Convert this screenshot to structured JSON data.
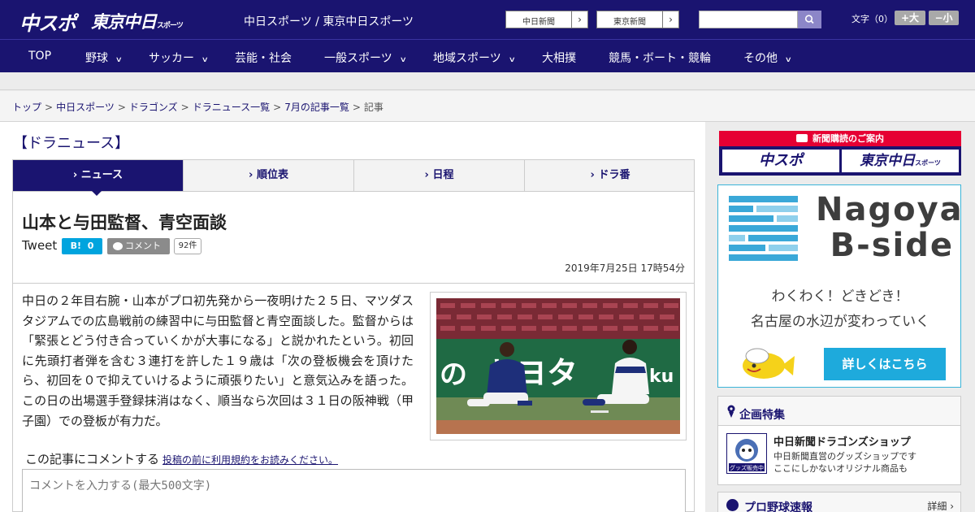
{
  "header": {
    "logo_chunichi": "中スポ",
    "logo_tokyo": "東京中日",
    "logo_tokyo_suffix": "スポーツ",
    "site_caption": "中日スポーツ / 東京中日スポーツ",
    "ext_links": [
      {
        "label": "中日新聞",
        "arrow": "›"
      },
      {
        "label": "東京新聞",
        "arrow": "›"
      }
    ],
    "search_placeholder": "",
    "font_size_label": "文字（0）",
    "font_bigger": "+大",
    "font_smaller": "−小"
  },
  "nav": {
    "items": [
      {
        "label": "TOP",
        "has_menu": false
      },
      {
        "label": "野球",
        "has_menu": true
      },
      {
        "label": "サッカー",
        "has_menu": true
      },
      {
        "label": "芸能・社会",
        "has_menu": false
      },
      {
        "label": "一般スポーツ",
        "has_menu": true
      },
      {
        "label": "地域スポーツ",
        "has_menu": true
      },
      {
        "label": "大相撲",
        "has_menu": false
      },
      {
        "label": "競馬・ボート・競輪",
        "has_menu": false
      },
      {
        "label": "その他",
        "has_menu": true
      }
    ],
    "chevron": "∨"
  },
  "breadcrumb": {
    "items": [
      "トップ",
      "中日スポーツ",
      "ドラゴンズ",
      "ドラニュース一覧",
      "7月の記事一覧"
    ],
    "current": "記事",
    "separator": ">"
  },
  "section_title": "【ドラニュース】",
  "tabs": [
    {
      "label": "ニュース",
      "active": true
    },
    {
      "label": "順位表",
      "active": false
    },
    {
      "label": "日程",
      "active": false
    },
    {
      "label": "ドラ番",
      "active": false
    }
  ],
  "tab_marker": "›",
  "article": {
    "headline": "山本と与田監督、青空面談",
    "tweet_label": "Tweet",
    "hatena_label": "B!",
    "hatena_count": "0",
    "comment_button": "コメント",
    "comment_count": "92件",
    "date": "2019年7月25日 17時54分",
    "body": "中日の２年目右腕・山本がプロ初先発から一夜明けた２５日、マツダスタジアムでの広島戦前の練習中に与田監督と青空面談した。監督からは「緊張とどう付き合っていくかが大事になる」と説かれたという。初回に先頭打者弾を含む３連打を許した１９歳は「次の登板機会を頂けたら、初回を０で抑えていけるように頑張りたい」と意気込みを語った。この日の出場選手登録抹消はなく、順当なら次回は３１日の阪神戦（甲子園）での登板が有力だ。",
    "photo_text_left": "の",
    "photo_text_mid": "トヨタ",
    "photo_text_right": "ku",
    "comment_prompt": "この記事にコメントする",
    "terms_link": "投稿の前に利用規約をお読みください。",
    "comment_placeholder": "コメントを入力する(最大500文字)"
  },
  "sidebar": {
    "subscribe_title": "新聞購読のご案内",
    "subscribe_chunichi": "中スポ",
    "subscribe_tokyo": "東京中日",
    "subscribe_tokyo_suffix": "スポーツ",
    "ad_title_line1": "Nagoya",
    "ad_title_line2": "B-side",
    "ad_line1": "わくわく！どきどき！",
    "ad_line2": "名古屋の水辺が変わっていく",
    "ad_cta": "詳しくはこちら",
    "kikaku_title": "企画特集",
    "shop_title": "中日新聞ドラゴンズショップ",
    "shop_desc1": "中日新聞直営のグッズショップです",
    "shop_desc2": "ここにしかないオリジナル商品も",
    "shop_thumb_label": "グッズ販売中",
    "sokuho_title": "プロ野球速報",
    "sokuho_more": "詳細 ›"
  },
  "colors": {
    "brand_navy": "#1a1470",
    "hatena_blue": "#00a4de",
    "subscribe_red": "#e60033",
    "ad_accent": "#1eaadc"
  }
}
